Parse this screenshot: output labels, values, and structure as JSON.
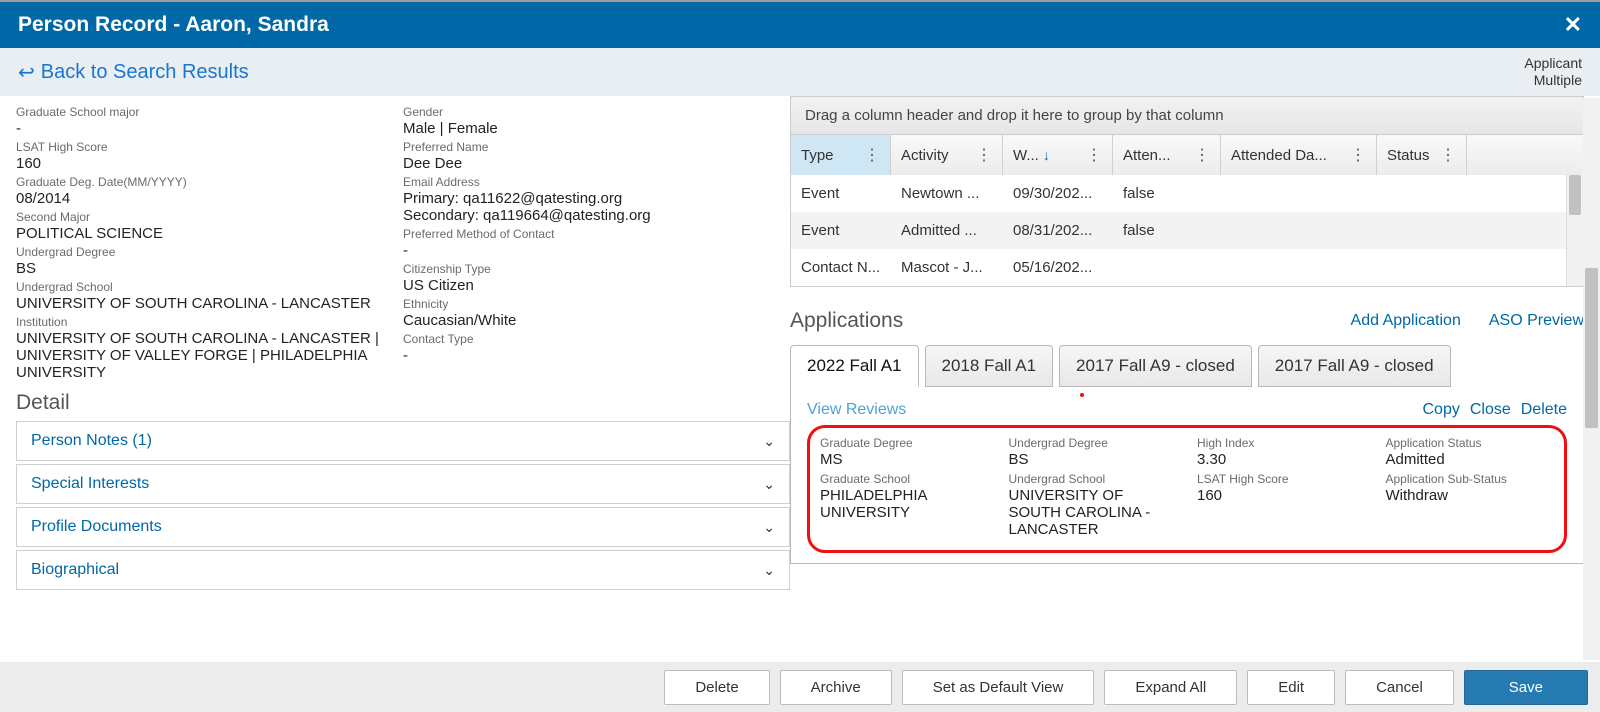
{
  "titlebar": {
    "title": "Person Record - Aaron, Sandra"
  },
  "back_link": "Back to Search Results",
  "applicant_badge": {
    "l1": "Applicant",
    "l2": "Multiple"
  },
  "left_fields": {
    "c1": [
      {
        "label": "Graduate School major",
        "value": "-"
      },
      {
        "label": "LSAT High Score",
        "value": "160"
      },
      {
        "label": "Graduate Deg. Date(MM/YYYY)",
        "value": "08/2014"
      },
      {
        "label": "Second Major",
        "value": "POLITICAL SCIENCE"
      },
      {
        "label": "Undergrad Degree",
        "value": "BS"
      },
      {
        "label": "Undergrad School",
        "value": "UNIVERSITY OF SOUTH CAROLINA - LANCASTER"
      },
      {
        "label": "Institution",
        "value": "UNIVERSITY OF SOUTH CAROLINA - LANCASTER | UNIVERSITY OF VALLEY FORGE | PHILADELPHIA UNIVERSITY"
      }
    ],
    "c2": [
      {
        "label": "Gender",
        "value": "Male | Female"
      },
      {
        "label": "Preferred Name",
        "value": "Dee Dee"
      },
      {
        "label": "Email Address",
        "value": "Primary: qa11622@qatesting.org\nSecondary: qa119664@qatesting.org"
      },
      {
        "label": "Preferred Method of Contact",
        "value": "-"
      },
      {
        "label": "Citizenship Type",
        "value": "US Citizen"
      },
      {
        "label": "Ethnicity",
        "value": "Caucasian/White"
      },
      {
        "label": "Contact Type",
        "value": "-"
      }
    ]
  },
  "detail_heading": "Detail",
  "accordions": [
    "Person Notes (1)",
    "Special Interests",
    "Profile Documents",
    "Biographical"
  ],
  "grid": {
    "group_hint": "Drag a column header and drop it here to group by that column",
    "headers": {
      "type": "Type",
      "activity": "Activity",
      "when": "W...",
      "atten": "Atten...",
      "attended_da": "Attended Da...",
      "status": "Status"
    },
    "rows": [
      {
        "type": "Event",
        "activity": "Newtown ...",
        "when": "09/30/202...",
        "atten": "false",
        "attended_da": "",
        "status": ""
      },
      {
        "type": "Event",
        "activity": "Admitted ...",
        "when": "08/31/202...",
        "atten": "false",
        "attended_da": "",
        "status": ""
      },
      {
        "type": "Contact N...",
        "activity": "Mascot - J...",
        "when": "05/16/202...",
        "atten": "",
        "attended_da": "",
        "status": ""
      }
    ]
  },
  "applications": {
    "heading": "Applications",
    "add": "Add Application",
    "aso": "ASO Preview",
    "tabs": [
      "2022 Fall A1",
      "2018 Fall A1",
      "2017 Fall A9 - closed",
      "2017 Fall A9 - closed"
    ],
    "active_tab": 0,
    "panel_links": {
      "view": "View Reviews",
      "copy": "Copy",
      "close": "Close",
      "delete": "Delete"
    }
  },
  "app_detail": {
    "grad_degree": {
      "l": "Graduate Degree",
      "v": "MS"
    },
    "grad_school": {
      "l": "Graduate School",
      "v": "PHILADELPHIA UNIVERSITY"
    },
    "ug_degree": {
      "l": "Undergrad Degree",
      "v": "BS"
    },
    "ug_school": {
      "l": "Undergrad School",
      "v": "UNIVERSITY OF SOUTH CAROLINA - LANCASTER"
    },
    "high_index": {
      "l": "High Index",
      "v": "3.30"
    },
    "lsat": {
      "l": "LSAT High Score",
      "v": "160"
    },
    "status": {
      "l": "Application Status",
      "v": "Admitted"
    },
    "substatus": {
      "l": "Application Sub-Status",
      "v": "Withdraw"
    }
  },
  "footer": {
    "delete": "Delete",
    "archive": "Archive",
    "default_view": "Set as Default View",
    "expand_all": "Expand All",
    "edit": "Edit",
    "cancel": "Cancel",
    "save": "Save"
  }
}
